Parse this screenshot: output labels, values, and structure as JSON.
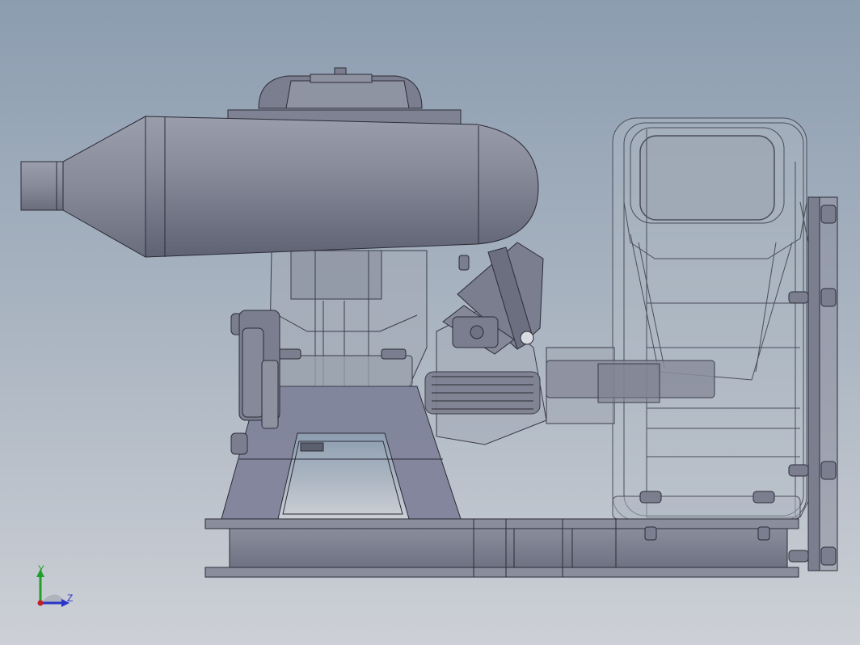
{
  "viewport": {
    "background_top": "#8c9db0",
    "background_bottom": "#c8ccd3"
  },
  "model": {
    "body_color": "#7b7e8e",
    "edge_color": "#2b2c36",
    "ghost_color": "#b9c0c9"
  },
  "triad": {
    "y_label": "Y",
    "z_label": "Z",
    "y_color": "#1fa02a",
    "z_color": "#2a35c8",
    "origin_color": "#c0202a"
  }
}
